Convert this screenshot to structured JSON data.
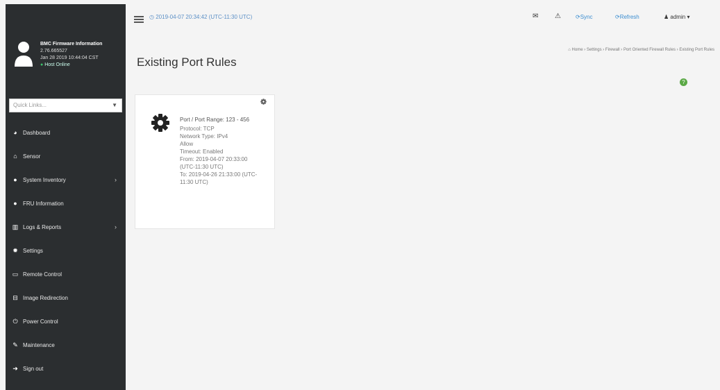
{
  "sidebar": {
    "user": {
      "title": "BMC Firmware Information",
      "version": "2.76.665527",
      "datetime": "Jan 28 2019 10:44:04 CST",
      "status": "Host Online"
    },
    "quick_links": {
      "placeholder": "Quick Links..."
    },
    "items": [
      {
        "label": "Dashboard",
        "icon": "dashboard-icon",
        "has_submenu": false
      },
      {
        "label": "Sensor",
        "icon": "sensor-icon",
        "has_submenu": false
      },
      {
        "label": "System Inventory",
        "icon": "info-icon",
        "has_submenu": true
      },
      {
        "label": "FRU Information",
        "icon": "info-icon",
        "has_submenu": false
      },
      {
        "label": "Logs & Reports",
        "icon": "chart-icon",
        "has_submenu": true
      },
      {
        "label": "Settings",
        "icon": "gear-icon",
        "has_submenu": false
      },
      {
        "label": "Remote Control",
        "icon": "monitor-icon",
        "has_submenu": false
      },
      {
        "label": "Image Redirection",
        "icon": "disk-icon",
        "has_submenu": false
      },
      {
        "label": "Power Control",
        "icon": "power-icon",
        "has_submenu": false
      },
      {
        "label": "Maintenance",
        "icon": "wrench-icon",
        "has_submenu": false
      },
      {
        "label": "Sign out",
        "icon": "sign-out-icon",
        "has_submenu": false
      }
    ]
  },
  "topbar": {
    "clock": "2019-04-07 20:34:42 (UTC-11:30 UTC)",
    "sync_label": "Sync",
    "refresh_label": "Refresh",
    "user_label": "admin"
  },
  "page": {
    "title": "Existing Port Rules",
    "breadcrumb": [
      "Home",
      "Settings",
      "Firewall",
      "Port Oriented Firewall Rules",
      "Existing Port Rules"
    ]
  },
  "rule_card": {
    "port_range": "Port / Port Range: 123 - 456",
    "protocol": "Protocol: TCP",
    "network_type": "Network Type: IPv4",
    "action": "Allow",
    "timeout": "Timeout: Enabled",
    "from": "From: 2019-04-07 20:33:00 (UTC-11:30 UTC)",
    "to": "To: 2019-04-26 21:33:00 (UTC-11:30 UTC)"
  },
  "colors": {
    "sidebar_bg": "#2b2e30",
    "accent_blue": "#3b8dd0",
    "online_green": "#39c36a",
    "help_green": "#5aa845"
  }
}
